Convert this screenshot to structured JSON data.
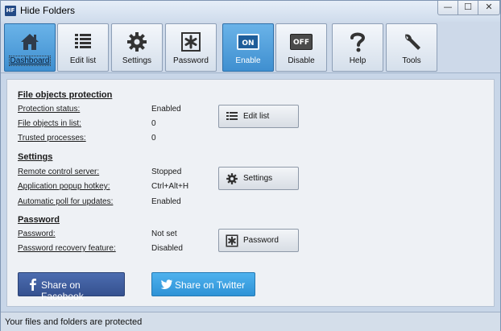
{
  "window": {
    "title": "Hide Folders",
    "icon_text": "HF",
    "controls": {
      "minimize": "—",
      "maximize": "☐",
      "close": "✕"
    }
  },
  "toolbar": {
    "items": [
      {
        "label": "Dashboard",
        "icon": "home-icon"
      },
      {
        "label": "Edit list",
        "icon": "list-icon"
      },
      {
        "label": "Settings",
        "icon": "gear-icon"
      },
      {
        "label": "Password",
        "icon": "asterisk-icon"
      },
      {
        "label": "Enable",
        "icon": "on-switch-icon",
        "badge": "ON"
      },
      {
        "label": "Disable",
        "icon": "off-switch-icon",
        "badge": "OFF"
      },
      {
        "label": "Help",
        "icon": "question-icon"
      },
      {
        "label": "Tools",
        "icon": "wrench-icon"
      }
    ],
    "active": [
      "Dashboard",
      "Enable"
    ]
  },
  "protection": {
    "title": "File objects protection",
    "rows": [
      {
        "label": "Protection status:",
        "value": "Enabled"
      },
      {
        "label": "File objects in list:",
        "value": "0"
      },
      {
        "label": "Trusted processes:",
        "value": "0"
      }
    ],
    "button": "Edit list"
  },
  "settings": {
    "title": "Settings",
    "rows": [
      {
        "label": "Remote control server:",
        "value": "Stopped"
      },
      {
        "label": "Application popup hotkey:",
        "value": "Ctrl+Alt+H"
      },
      {
        "label": "Automatic poll for updates:",
        "value": "Enabled"
      }
    ],
    "button": "Settings"
  },
  "password": {
    "title": "Password",
    "rows": [
      {
        "label": "Password:",
        "value": "Not set"
      },
      {
        "label": "Password recovery feature:",
        "value": "Disabled"
      }
    ],
    "button": "Password"
  },
  "social": {
    "facebook": "Share on Facebook",
    "twitter": "Share on Twitter"
  },
  "colors": {
    "accent": "#3f8fd0",
    "facebook": "#3b5998",
    "twitter": "#3aa3e3"
  },
  "status": "Your files and folders are protected"
}
